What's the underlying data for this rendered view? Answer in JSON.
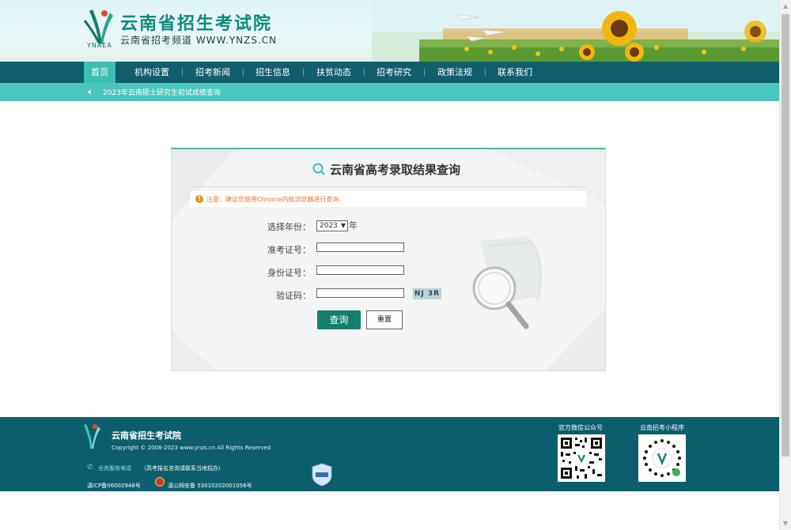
{
  "header": {
    "site_name": "云南省招生考试院",
    "site_sub": "云南省招考频道 WWW.YNZS.CN",
    "logo_abbr": "YNAEA"
  },
  "nav": {
    "items": [
      {
        "label": "首页",
        "active": true
      },
      {
        "label": "机构设置"
      },
      {
        "label": "招考新闻"
      },
      {
        "label": "招生信息"
      },
      {
        "label": "扶贫动态"
      },
      {
        "label": "招考研究"
      },
      {
        "label": "政策法规"
      },
      {
        "label": "联系我们"
      }
    ]
  },
  "notice": {
    "text": "2023年云南硕士研究生初试成绩查询"
  },
  "query": {
    "title": "云南省高考录取结果查询",
    "warning_icon": "!",
    "warning": "注意：建议您使用Chrome内核浏览器进行查询.",
    "year_label": "选择年份：",
    "year_value": "2023",
    "year_suffix": "年",
    "exam_no_label": "准考证号：",
    "id_label": "身份证号：",
    "captcha_label": "验证码：",
    "captcha_image_text": "NJ 3R",
    "query_button": "查询",
    "reset_button": "重置"
  },
  "footer": {
    "name": "云南省招生考试院",
    "copyright": "Copyright © 2008-2023 www.ynzs.cn All Rights Reserved",
    "phone_label": "业务服务电话",
    "phone_note": "（高考报名咨询请联系当地招办）",
    "icp": "滇ICP备06002948号",
    "police": "滇公网安备 53010202001056号",
    "wechat_title": "官方微信公众号",
    "mini_title": "云南招考小程序"
  },
  "colors": {
    "nav": "#115e6d",
    "nav_active": "#3fbfb3",
    "notice_bar": "#4cc5bd",
    "footer": "#0d5e6c",
    "primary_button": "#147f6c",
    "warning": "#e9742e"
  }
}
